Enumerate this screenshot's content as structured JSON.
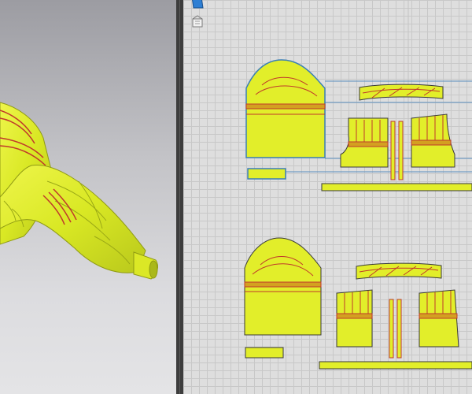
{
  "colors": {
    "fabric": "#e2ee2a",
    "fabric_shade": "#a9b81a",
    "seam": "#c0392b",
    "outline": "#3a3a3a",
    "guide": "#5b8fbf",
    "grid_bg": "#dedede"
  },
  "toolbar": {
    "icons": [
      "select-mesh-icon",
      "fold-arrange-icon"
    ]
  }
}
